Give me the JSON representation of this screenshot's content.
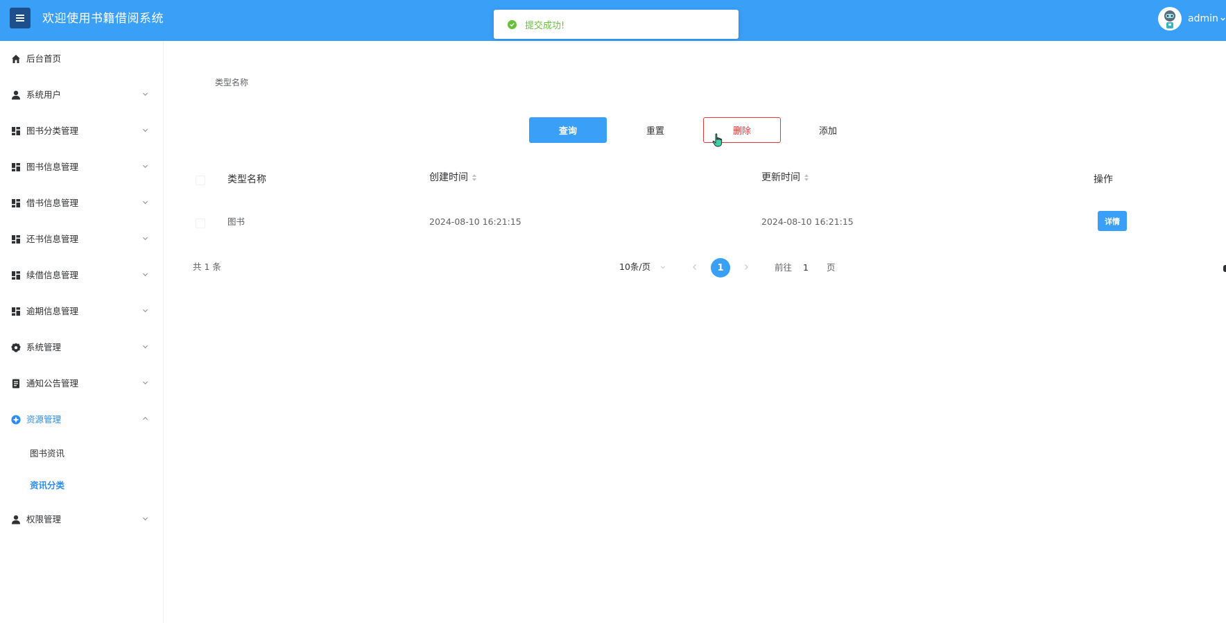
{
  "header": {
    "title": "欢迎使用书籍借阅系统",
    "user": "admin",
    "toast": "提交成功!"
  },
  "sidebar": {
    "items": [
      {
        "label": "后台首页",
        "icon": "home-icon"
      },
      {
        "label": "系统用户",
        "icon": "user-icon"
      },
      {
        "label": "图书分类管理",
        "icon": "grid-icon"
      },
      {
        "label": "图书信息管理",
        "icon": "grid-icon"
      },
      {
        "label": "借书信息管理",
        "icon": "grid-icon"
      },
      {
        "label": "还书信息管理",
        "icon": "grid-icon"
      },
      {
        "label": "续借信息管理",
        "icon": "grid-icon"
      },
      {
        "label": "逾期信息管理",
        "icon": "grid-icon"
      },
      {
        "label": "系统管理",
        "icon": "gear-icon"
      },
      {
        "label": "通知公告管理",
        "icon": "document-icon"
      },
      {
        "label": "资源管理",
        "icon": "resource-icon"
      },
      {
        "label": "权限管理",
        "icon": "user-icon"
      }
    ],
    "subitems": [
      {
        "label": "图书资讯"
      },
      {
        "label": "资讯分类"
      }
    ],
    "active_color": "#2d8cf0"
  },
  "search": {
    "label": "类型名称",
    "buttons": {
      "query": "查询",
      "reset": "重置",
      "delete": "删除",
      "add": "添加"
    }
  },
  "table": {
    "columns": [
      "类型名称",
      "创建时间",
      "更新时间",
      "操作"
    ],
    "rows": [
      {
        "name": "图书",
        "created": "2024-08-10 16:21:15",
        "updated": "2024-08-10 16:21:15",
        "action": "详情"
      }
    ]
  },
  "pagination": {
    "total_text": "共 1 条",
    "page_size": "10条/页",
    "current_page": "1",
    "goto_prefix": "前往",
    "goto_value": "1",
    "goto_suffix": "页"
  },
  "colors": {
    "primary": "#3a9ff7",
    "danger": "#e23a3a",
    "success": "#67c23a",
    "menu_button": "#1c4f8c"
  }
}
